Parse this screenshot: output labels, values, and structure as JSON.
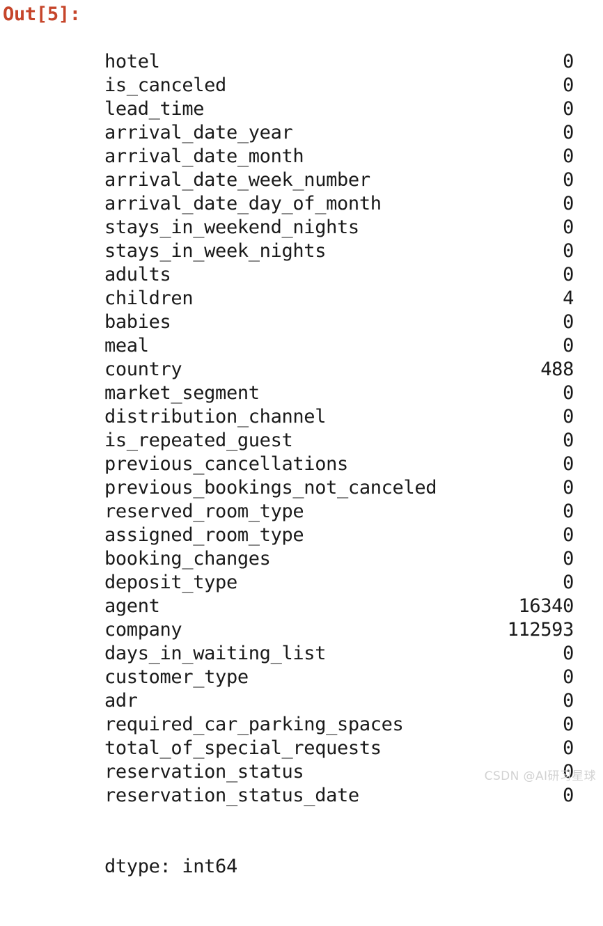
{
  "cell": {
    "prompt_label": "Out[5]:",
    "prompt_color": "#c6452a",
    "text_color": "#1a1a1a",
    "background": "#ffffff"
  },
  "series": {
    "dtype_line": "dtype: int64",
    "rows": [
      {
        "index": "hotel",
        "value": "0"
      },
      {
        "index": "is_canceled",
        "value": "0"
      },
      {
        "index": "lead_time",
        "value": "0"
      },
      {
        "index": "arrival_date_year",
        "value": "0"
      },
      {
        "index": "arrival_date_month",
        "value": "0"
      },
      {
        "index": "arrival_date_week_number",
        "value": "0"
      },
      {
        "index": "arrival_date_day_of_month",
        "value": "0"
      },
      {
        "index": "stays_in_weekend_nights",
        "value": "0"
      },
      {
        "index": "stays_in_week_nights",
        "value": "0"
      },
      {
        "index": "adults",
        "value": "0"
      },
      {
        "index": "children",
        "value": "4"
      },
      {
        "index": "babies",
        "value": "0"
      },
      {
        "index": "meal",
        "value": "0"
      },
      {
        "index": "country",
        "value": "488"
      },
      {
        "index": "market_segment",
        "value": "0"
      },
      {
        "index": "distribution_channel",
        "value": "0"
      },
      {
        "index": "is_repeated_guest",
        "value": "0"
      },
      {
        "index": "previous_cancellations",
        "value": "0"
      },
      {
        "index": "previous_bookings_not_canceled",
        "value": "0"
      },
      {
        "index": "reserved_room_type",
        "value": "0"
      },
      {
        "index": "assigned_room_type",
        "value": "0"
      },
      {
        "index": "booking_changes",
        "value": "0"
      },
      {
        "index": "deposit_type",
        "value": "0"
      },
      {
        "index": "agent",
        "value": "16340"
      },
      {
        "index": "company",
        "value": "112593"
      },
      {
        "index": "days_in_waiting_list",
        "value": "0"
      },
      {
        "index": "customer_type",
        "value": "0"
      },
      {
        "index": "adr",
        "value": "0"
      },
      {
        "index": "required_car_parking_spaces",
        "value": "0"
      },
      {
        "index": "total_of_special_requests",
        "value": "0"
      },
      {
        "index": "reservation_status",
        "value": "0"
      },
      {
        "index": "reservation_status_date",
        "value": "0"
      }
    ]
  },
  "watermark": {
    "text": "CSDN @AI研习星球",
    "color": "#d2d2d2"
  }
}
